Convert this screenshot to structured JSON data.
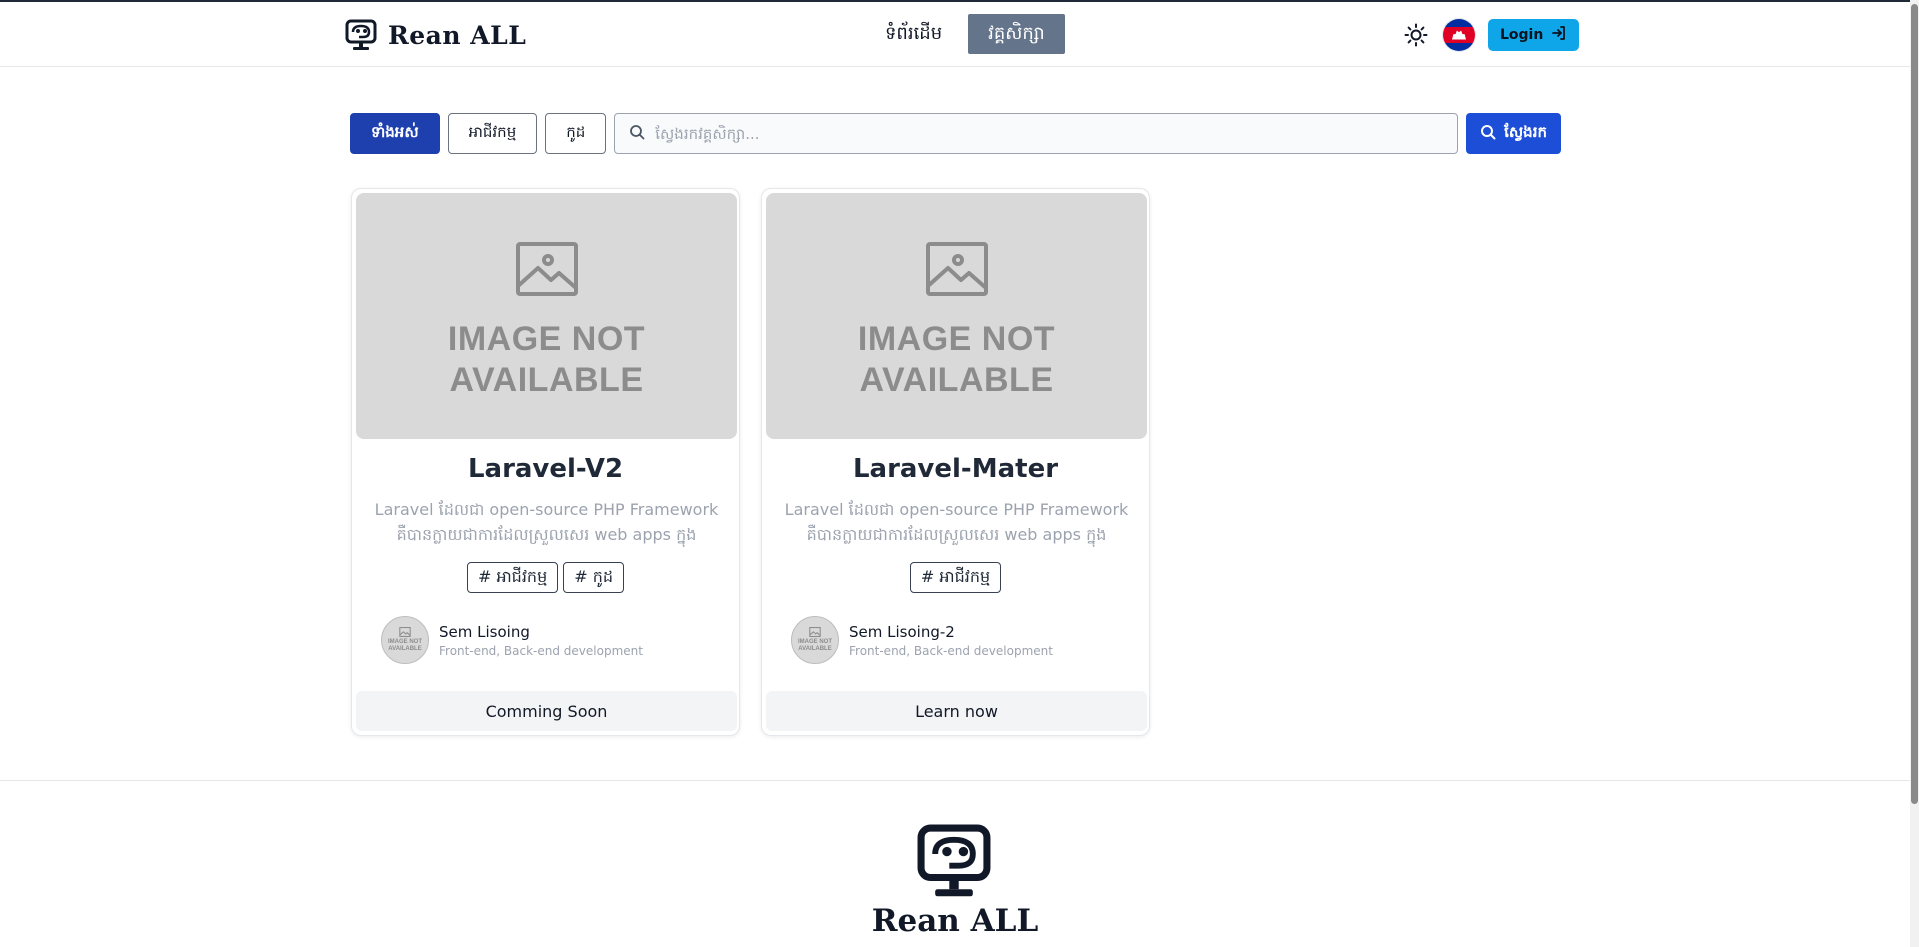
{
  "header": {
    "brand_name": "Rean ALL",
    "nav": [
      {
        "label": "ទំព័រដើម",
        "active": false
      },
      {
        "label": "វគ្គសិក្សា",
        "active": true
      }
    ],
    "login_label": "Login"
  },
  "filters": {
    "buttons": [
      {
        "label": "ទាំងអស់",
        "active": true
      },
      {
        "label": "អាជីវកម្ម",
        "active": false
      },
      {
        "label": "កូដ",
        "active": false
      }
    ],
    "search_placeholder": "ស្វែងរកវគ្គសិក្សា...",
    "search_button": "ស្វែងរក"
  },
  "courses": [
    {
      "image_text": "IMAGE NOT AVAILABLE",
      "title": "Laravel-V2",
      "description": "Laravel ដែលជា open-source PHP Framework គឺបានក្លាយជាការដែលស្រួលសេរ web apps ក្នុងល្បឿន...",
      "tags": [
        "# អាជីវកម្ម",
        "# កូដ"
      ],
      "author_name": "Sem Lisoing",
      "author_role": "Front-end, Back-end development",
      "avatar_text": "IMAGE NOT AVAILABLE",
      "action": "Comming Soon"
    },
    {
      "image_text": "IMAGE NOT AVAILABLE",
      "title": "Laravel-Mater",
      "description": "Laravel ដែលជា open-source PHP Framework គឺបានក្លាយជាការដែលស្រួលសេរ web apps ក្នុងល្បឿន...",
      "tags": [
        "# អាជីវកម្ម"
      ],
      "author_name": "Sem Lisoing-2",
      "author_role": "Front-end, Back-end development",
      "avatar_text": "IMAGE NOT AVAILABLE",
      "action": "Learn now"
    }
  ],
  "footer": {
    "brand_name": "Rean ALL"
  },
  "icons": {
    "logo": "brain-monitor-icon",
    "theme": "sun-icon",
    "language": "cambodia-flag-icon",
    "login": "login-arrow-icon",
    "search": "search-icon",
    "image_placeholder": "image-icon"
  },
  "colors": {
    "nav_active_bg": "#64748b",
    "filter_active_bg": "#1e40af",
    "search_button_bg": "#1d4ed8",
    "login_button_bg": "#0ea5e9"
  }
}
